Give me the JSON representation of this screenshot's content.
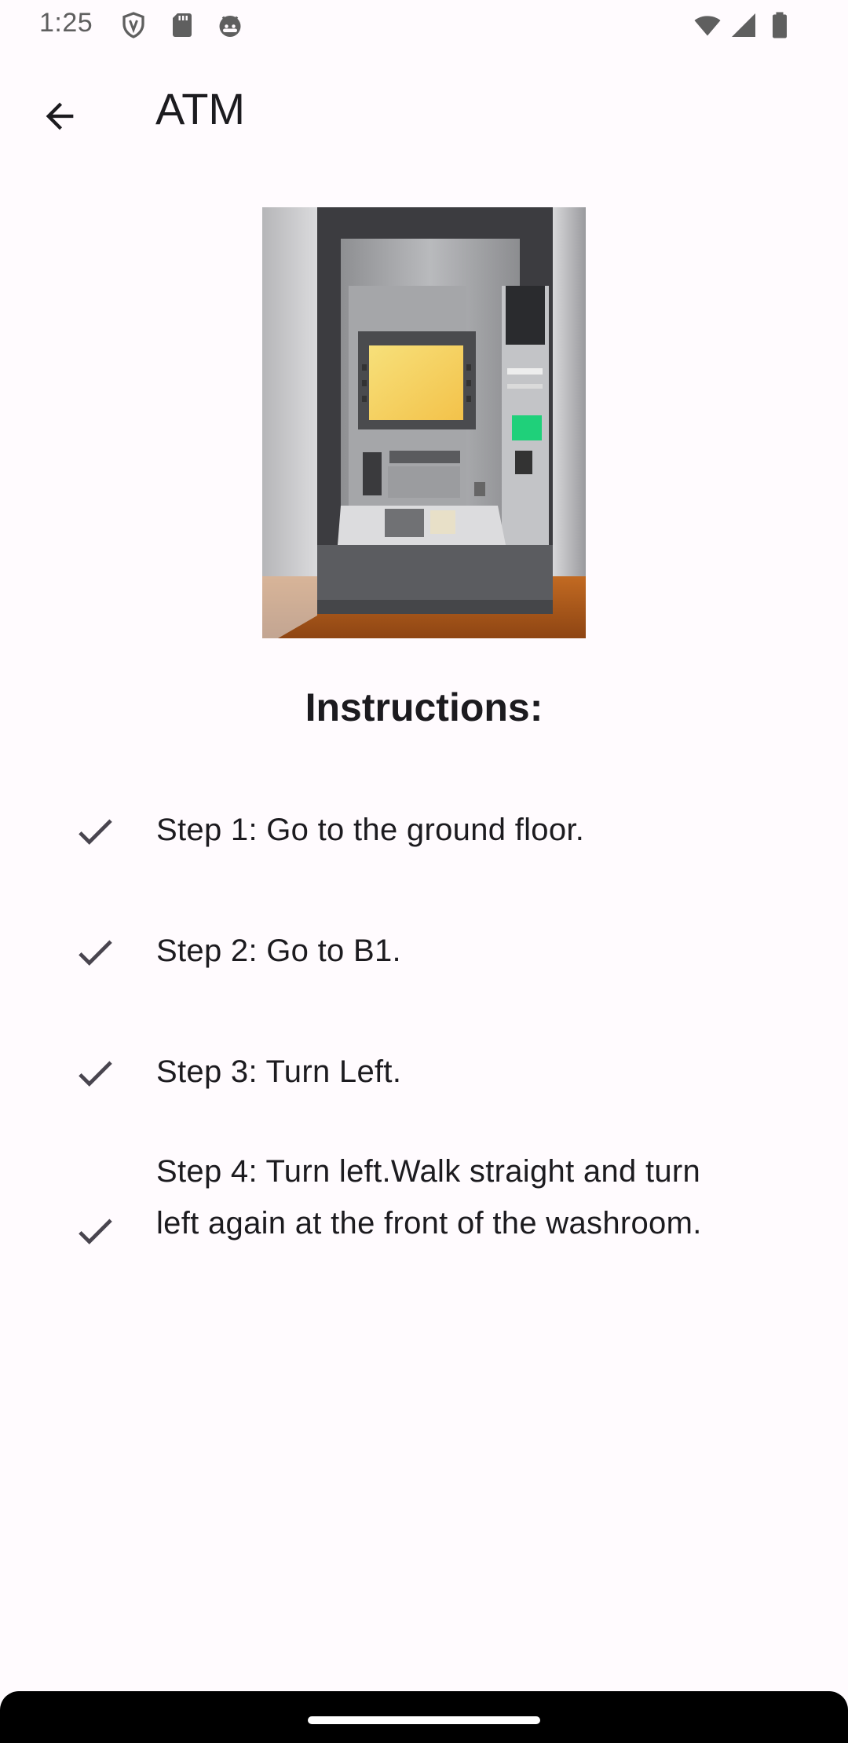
{
  "status_bar": {
    "time": "1:25",
    "icons": [
      "shield-icon",
      "sd-card-icon",
      "android-face-icon",
      "wifi-icon",
      "cellular-signal-icon",
      "battery-icon"
    ]
  },
  "app_bar": {
    "title": "ATM",
    "back_icon": "arrow-back-icon"
  },
  "image": {
    "subject": "atm-machine-photo"
  },
  "instructions": {
    "heading": "Instructions:",
    "steps": [
      {
        "text": "Step 1: Go to the ground floor.",
        "icon": "check-icon"
      },
      {
        "text": "Step 2: Go to B1.",
        "icon": "check-icon"
      },
      {
        "text": "Step 3: Turn Left.",
        "icon": "check-icon"
      },
      {
        "text": "Step 4: Turn left.Walk straight and turn left again at the front of the washroom.",
        "icon": "check-icon"
      }
    ]
  },
  "colors": {
    "background": "#FFFBFE",
    "text": "#1C1B1F",
    "status_icons": "#5F5F5F"
  }
}
